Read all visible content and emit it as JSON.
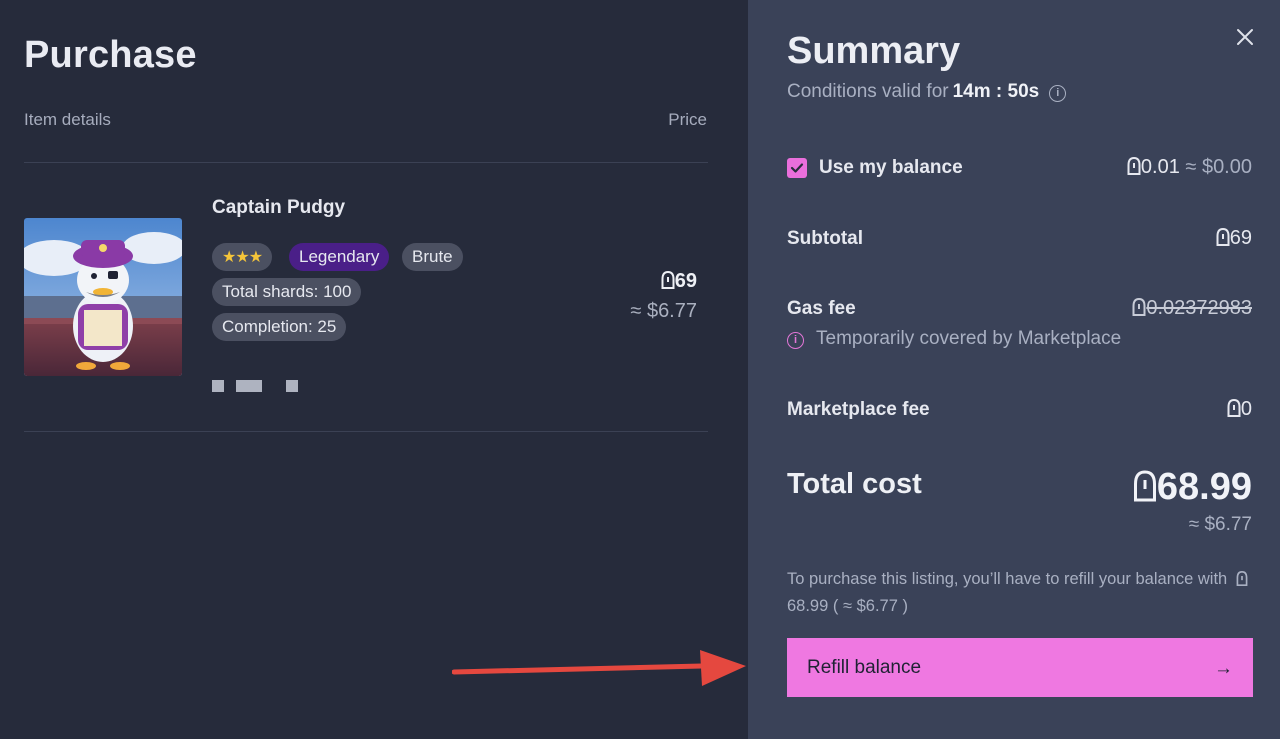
{
  "purchase": {
    "title": "Purchase",
    "col_item_details": "Item details",
    "col_price": "Price",
    "item": {
      "name": "Captain Pudgy",
      "stars": "★★★",
      "rarity": "Legendary",
      "class": "Brute",
      "total_shards": "Total shards: 100",
      "completion": "Completion: 25",
      "price": "69",
      "price_usd": "≈ $6.77"
    }
  },
  "summary": {
    "title": "Summary",
    "conditions_label": "Conditions valid for",
    "conditions_timer": "14m : 50s",
    "use_balance_label": "Use my balance",
    "use_balance_checked": true,
    "use_balance_amount": "0.01",
    "use_balance_usd": "≈ $0.00",
    "subtotal_label": "Subtotal",
    "subtotal_value": "69",
    "gas_fee_label": "Gas fee",
    "gas_fee_value": "0.02372983",
    "gas_fee_note": "Temporarily covered by Marketplace",
    "marketplace_fee_label": "Marketplace fee",
    "marketplace_fee_value": "0",
    "total_label": "Total cost",
    "total_value": "68.99",
    "total_usd": "≈ $6.77",
    "notice_text": "To purchase this listing, you’ll have to refill your balance with",
    "notice_amount": "68.99 ( ≈ $6.77 )",
    "refill_label": "Refill balance",
    "refill_arrow": "→"
  },
  "colors": {
    "left_bg": "#262b3b",
    "right_bg": "#3a4258",
    "accent_pink": "#ef78e1",
    "legendary_purple": "#4a1f88",
    "annotation_red": "#e5483f"
  },
  "icons": {
    "close": "close-icon",
    "info": "info-icon",
    "coin": "coin-icon",
    "check": "check-icon",
    "arrow_right": "arrow-right-icon"
  }
}
